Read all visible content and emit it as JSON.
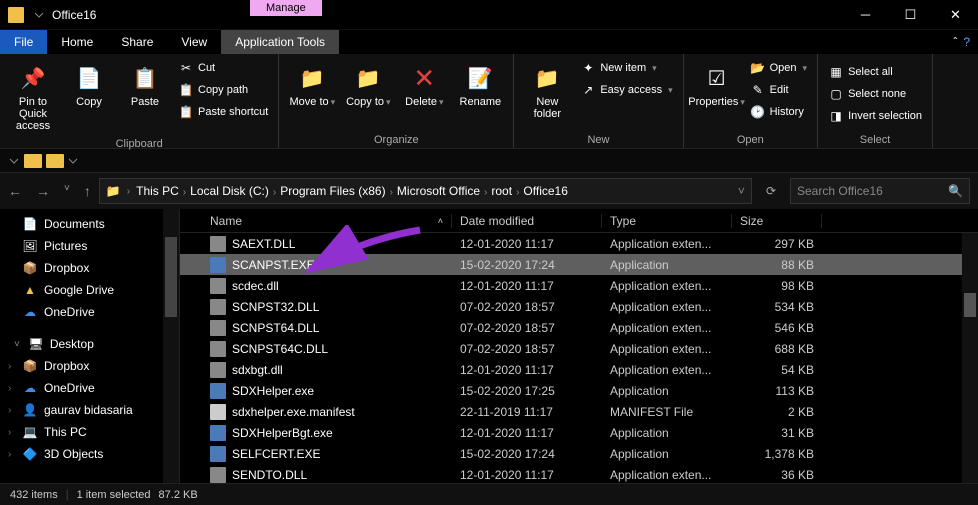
{
  "title": "Office16",
  "contextTab": "Manage",
  "tabs": {
    "file": "File",
    "home": "Home",
    "share": "Share",
    "view": "View",
    "app": "Application Tools"
  },
  "ribbon": {
    "pin": "Pin to Quick access",
    "copy": "Copy",
    "paste": "Paste",
    "cut": "Cut",
    "copyPath": "Copy path",
    "pasteShortcut": "Paste shortcut",
    "moveTo": "Move to",
    "copyTo": "Copy to",
    "delete": "Delete",
    "rename": "Rename",
    "newFolder": "New folder",
    "newItem": "New item",
    "easyAccess": "Easy access",
    "properties": "Properties",
    "open": "Open",
    "edit": "Edit",
    "history": "History",
    "selectAll": "Select all",
    "selectNone": "Select none",
    "invert": "Invert selection",
    "groups": {
      "clipboard": "Clipboard",
      "organize": "Organize",
      "new": "New",
      "open": "Open",
      "select": "Select"
    }
  },
  "breadcrumb": [
    "This PC",
    "Local Disk (C:)",
    "Program Files (x86)",
    "Microsoft Office",
    "root",
    "Office16"
  ],
  "search": {
    "placeholder": "Search Office16"
  },
  "sidebar": {
    "items": [
      {
        "icon": "📄",
        "label": "Documents"
      },
      {
        "icon": "🖼",
        "label": "Pictures"
      },
      {
        "icon": "📦",
        "label": "Dropbox"
      },
      {
        "icon": "▲",
        "label": "Google Drive",
        "color": "#f0c048"
      },
      {
        "icon": "☁",
        "label": "OneDrive",
        "color": "#3a8ee6"
      }
    ],
    "desktop": {
      "icon": "🖥",
      "label": "Desktop",
      "color": "#3a8ee6"
    },
    "below": [
      {
        "icon": "📦",
        "label": "Dropbox"
      },
      {
        "icon": "☁",
        "label": "OneDrive",
        "color": "#3a8ee6"
      },
      {
        "icon": "👤",
        "label": "gaurav bidasaria"
      },
      {
        "icon": "💻",
        "label": "This PC",
        "color": "#3a8ee6"
      },
      {
        "icon": "🔷",
        "label": "3D Objects",
        "color": "#3a8ee6"
      }
    ]
  },
  "columns": {
    "name": "Name",
    "date": "Date modified",
    "type": "Type",
    "size": "Size"
  },
  "files": [
    {
      "name": "SAEXT.DLL",
      "date": "12-01-2020 11:17",
      "type": "Application exten...",
      "size": "297 KB",
      "kind": "dll"
    },
    {
      "name": "SCANPST.EXE",
      "date": "15-02-2020 17:24",
      "type": "Application",
      "size": "88 KB",
      "kind": "exe",
      "selected": true
    },
    {
      "name": "scdec.dll",
      "date": "12-01-2020 11:17",
      "type": "Application exten...",
      "size": "98 KB",
      "kind": "dll"
    },
    {
      "name": "SCNPST32.DLL",
      "date": "07-02-2020 18:57",
      "type": "Application exten...",
      "size": "534 KB",
      "kind": "dll"
    },
    {
      "name": "SCNPST64.DLL",
      "date": "07-02-2020 18:57",
      "type": "Application exten...",
      "size": "546 KB",
      "kind": "dll"
    },
    {
      "name": "SCNPST64C.DLL",
      "date": "07-02-2020 18:57",
      "type": "Application exten...",
      "size": "688 KB",
      "kind": "dll"
    },
    {
      "name": "sdxbgt.dll",
      "date": "12-01-2020 11:17",
      "type": "Application exten...",
      "size": "54 KB",
      "kind": "dll"
    },
    {
      "name": "SDXHelper.exe",
      "date": "15-02-2020 17:25",
      "type": "Application",
      "size": "113 KB",
      "kind": "exe"
    },
    {
      "name": "sdxhelper.exe.manifest",
      "date": "22-11-2019 11:17",
      "type": "MANIFEST File",
      "size": "2 KB",
      "kind": "file"
    },
    {
      "name": "SDXHelperBgt.exe",
      "date": "12-01-2020 11:17",
      "type": "Application",
      "size": "31 KB",
      "kind": "exe"
    },
    {
      "name": "SELFCERT.EXE",
      "date": "15-02-2020 17:24",
      "type": "Application",
      "size": "1,378 KB",
      "kind": "exe"
    },
    {
      "name": "SENDTO.DLL",
      "date": "12-01-2020 11:17",
      "type": "Application exten...",
      "size": "36 KB",
      "kind": "dll"
    }
  ],
  "status": {
    "count": "432 items",
    "selected": "1 item selected",
    "size": "87.2 KB"
  }
}
